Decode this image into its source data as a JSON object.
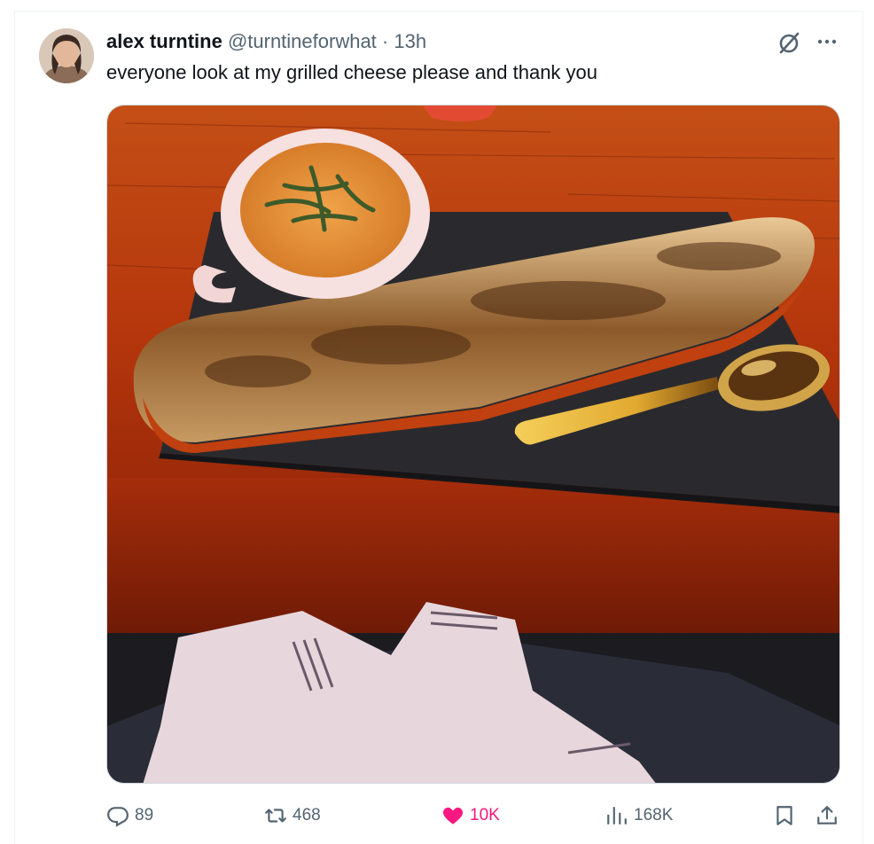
{
  "tweet": {
    "author_name": "alex turntine",
    "author_handle": "@turntineforwhat",
    "separator": " · ",
    "time": "13h",
    "text": "everyone look at my grilled cheese please and thank you"
  },
  "icons": {
    "grok": "grok-icon",
    "more": "more-icon",
    "reply": "reply-icon",
    "retweet": "retweet-icon",
    "like": "heart-icon",
    "views": "views-icon",
    "bookmark": "bookmark-icon",
    "share": "share-icon"
  },
  "actions": {
    "replies": "89",
    "retweets": "468",
    "likes": "10K",
    "views": "168K"
  },
  "colors": {
    "text": "#0f1419",
    "secondary": "#536471",
    "like_active": "#f91880"
  }
}
